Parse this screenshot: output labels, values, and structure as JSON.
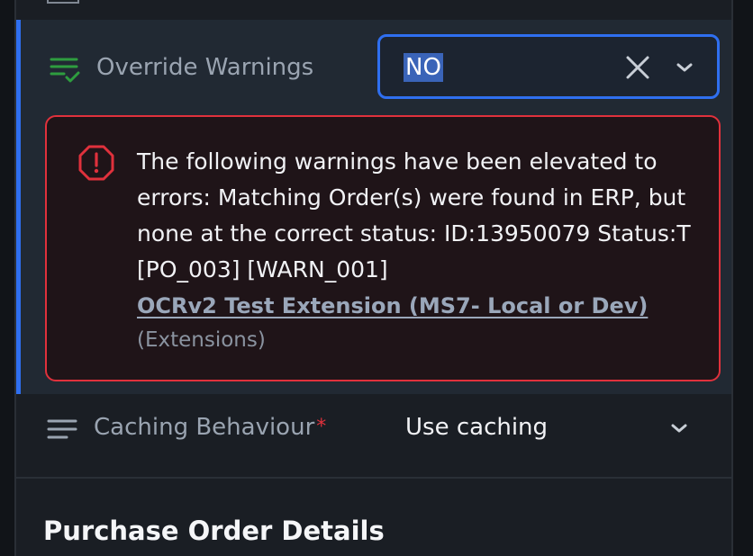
{
  "override": {
    "label": "Override Warnings",
    "selected_value": "NO",
    "icon": "list-check-icon",
    "accent_color": "#2f6ff0",
    "icon_color": "#2e9d3f"
  },
  "error": {
    "message": "The following warnings have been elevated to errors: Matching Order(s) were found in ERP, but none at the correct status: ID:13950079 Status:T [PO_003] [WARN_001]",
    "link_text": "OCRv2 Test Extension (MS7- Local or Dev)",
    "sub_text": "(Extensions)",
    "border_color": "#e0313c",
    "icon": "error-octagon-icon"
  },
  "caching": {
    "label": "Caching Behaviour",
    "required_mark": "*",
    "selected_value": "Use caching",
    "icon": "lines-icon"
  },
  "section": {
    "heading": "Purchase Order Details"
  }
}
